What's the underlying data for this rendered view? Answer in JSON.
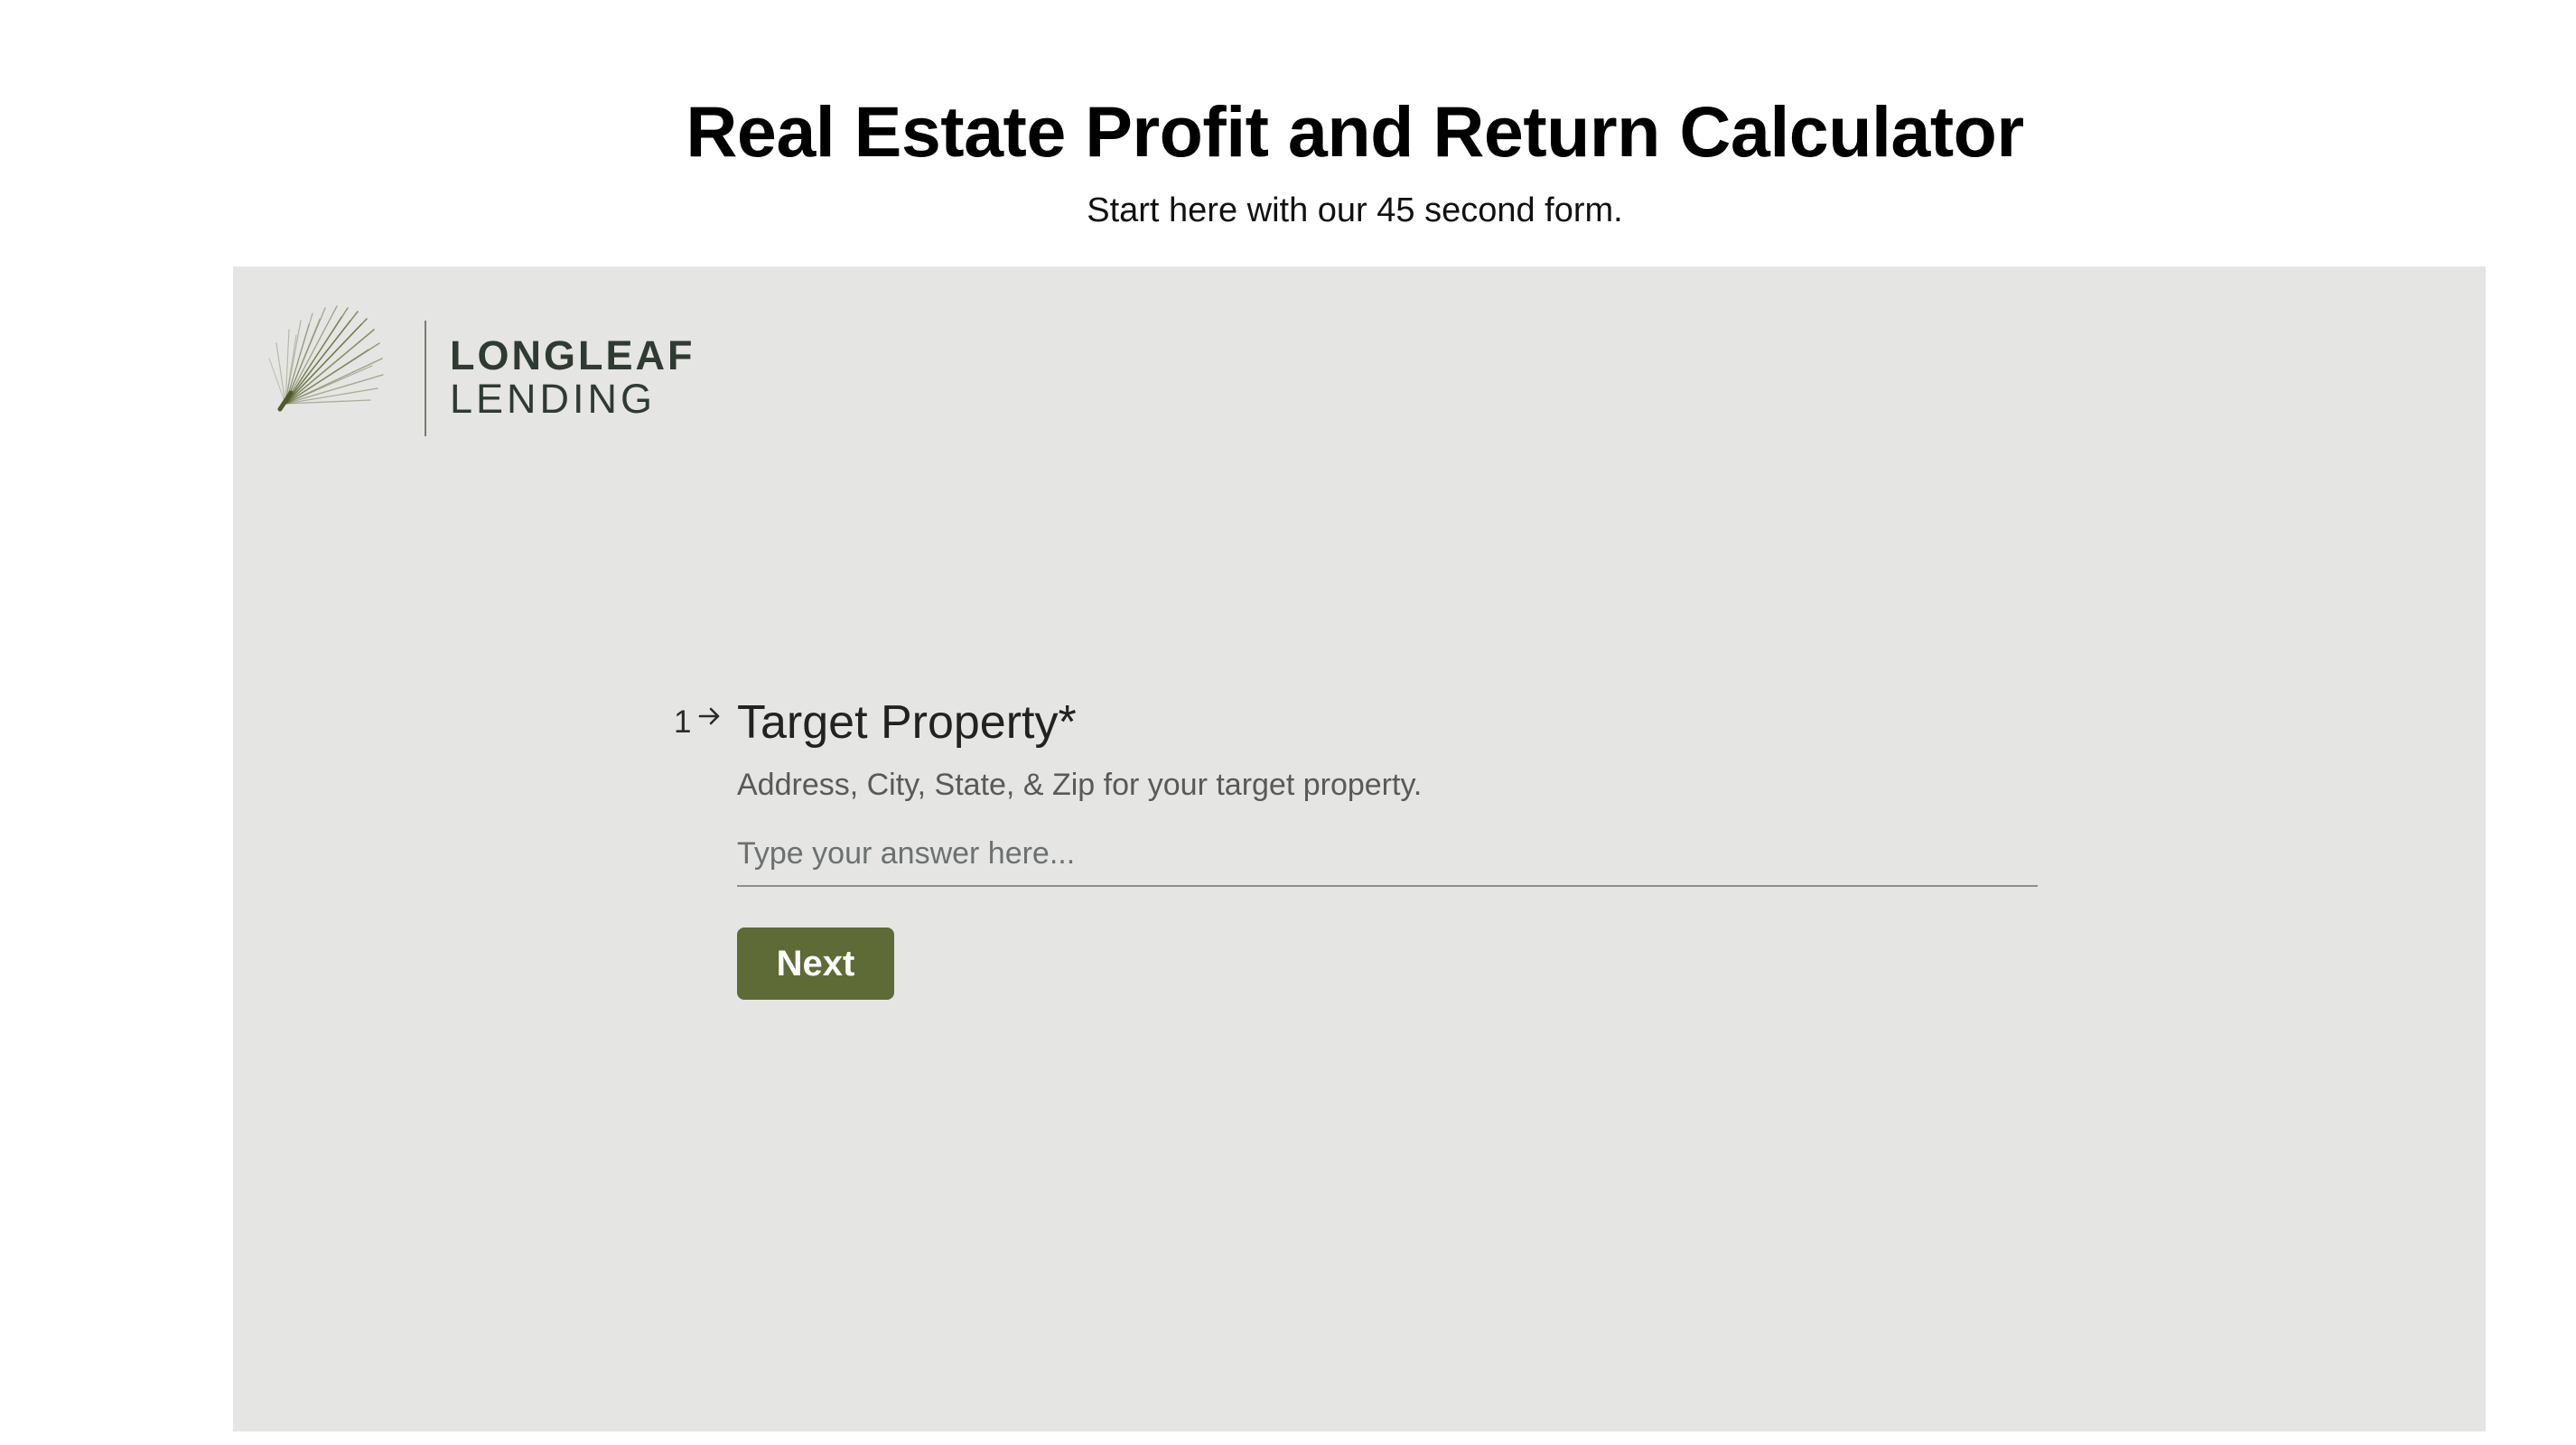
{
  "header": {
    "title": "Real Estate Profit and Return Calculator",
    "subtitle": "Start here with our 45 second form."
  },
  "logo": {
    "line1": "LONGLEAF",
    "line2": "LENDING",
    "icon": "pine-needle-icon",
    "brand_color": "#2f3b32",
    "needle_color": "#5f6b37"
  },
  "question": {
    "number": "1",
    "arrow_icon": "arrow-right-icon",
    "title": "Target Property*",
    "help_text": "Address, City, State, & Zip for your target property.",
    "input_value": "",
    "input_placeholder": "Type your answer here...",
    "next_label": "Next"
  },
  "colors": {
    "panel_background": "#e5e5e3",
    "button_background": "#5f6b37",
    "button_text": "#ffffff"
  }
}
